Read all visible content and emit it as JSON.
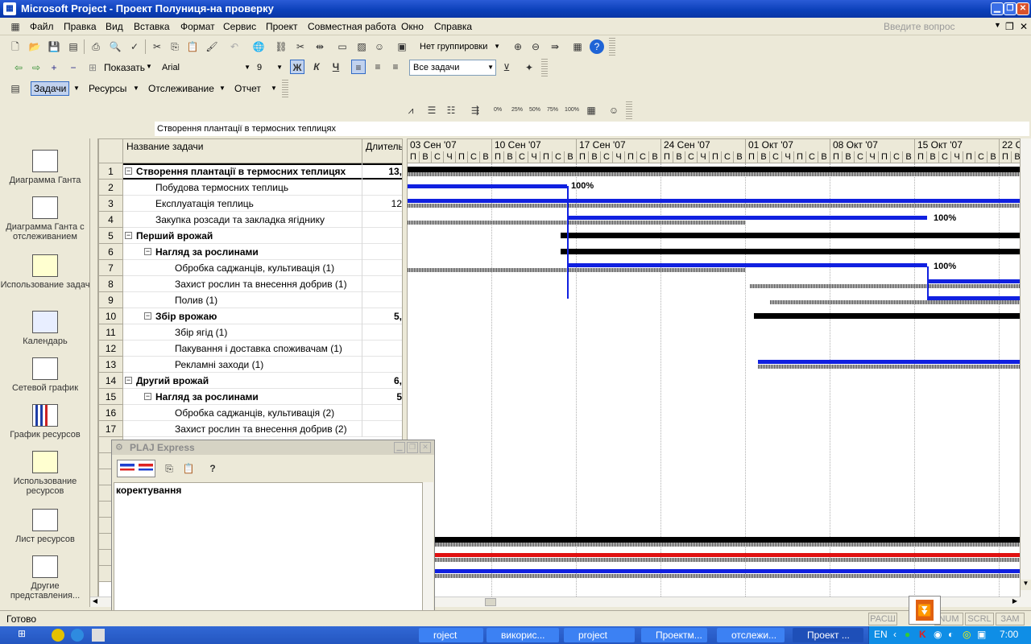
{
  "window": {
    "title": "Microsoft Project - Проект Полуниця-на проверку"
  },
  "menu": [
    "Файл",
    "Правка",
    "Вид",
    "Вставка",
    "Формат",
    "Сервис",
    "Проект",
    "Совместная работа",
    "Окно",
    "Справка"
  ],
  "help_box": {
    "placeholder": "Введите вопрос"
  },
  "toolbar": {
    "grouping": "Нет группировки",
    "show_label": "Показать",
    "font": "Arial",
    "font_size": "9",
    "bold": "Ж",
    "italic": "К",
    "underline": "Ч",
    "filter": "Все задачи",
    "tasks_btn": "Задачи",
    "resources_btn": "Ресурсы",
    "tracking_btn": "Отслеживание",
    "report_btn": "Отчет",
    "pct": [
      "0%",
      "25%",
      "50%",
      "75%",
      "100%"
    ]
  },
  "entry_bar": {
    "value": "Створення плантації  в термосних теплицях"
  },
  "view_bar": [
    {
      "label": "Диаграмма Ганта"
    },
    {
      "label": "Диаграмма Ганта с отслеживанием"
    },
    {
      "label": "Использование задач"
    },
    {
      "label": "Календарь"
    },
    {
      "label": "Сетевой график"
    },
    {
      "label": "График ресурсов"
    },
    {
      "label": "Использование ресурсов"
    },
    {
      "label": "Лист ресурсов"
    },
    {
      "label": "Другие представления..."
    }
  ],
  "grid": {
    "col_name": "Название задачи",
    "col_dur": "Длитель",
    "rows": [
      {
        "id": "1",
        "name": "Створення плантації  в термосних теплицях",
        "dur": "13,",
        "bold": true,
        "collapse": "⊟",
        "indent": 0
      },
      {
        "id": "2",
        "name": "Побудова термосних теплиць",
        "dur": "",
        "bold": false,
        "collapse": "",
        "indent": 1
      },
      {
        "id": "3",
        "name": "Експлуатація теплиць",
        "dur": "12",
        "bold": false,
        "collapse": "",
        "indent": 1
      },
      {
        "id": "4",
        "name": "Закупка розсади та закладка ягіднику",
        "dur": "",
        "bold": false,
        "collapse": "",
        "indent": 1
      },
      {
        "id": "5",
        "name": "Перший врожай",
        "dur": "",
        "bold": true,
        "collapse": "⊟",
        "indent": 0
      },
      {
        "id": "6",
        "name": "Нагляд за рослинами",
        "dur": "",
        "bold": true,
        "collapse": "⊟",
        "indent": 1
      },
      {
        "id": "7",
        "name": "Обробка саджанців, культивація (1)",
        "dur": "",
        "bold": false,
        "collapse": "",
        "indent": 2
      },
      {
        "id": "8",
        "name": "Захист рослин та внесення добрив (1)",
        "dur": "",
        "bold": false,
        "collapse": "",
        "indent": 2
      },
      {
        "id": "9",
        "name": "Полив (1)",
        "dur": "",
        "bold": false,
        "collapse": "",
        "indent": 2
      },
      {
        "id": "10",
        "name": "Збір врожаю",
        "dur": "5,",
        "bold": true,
        "collapse": "⊟",
        "indent": 1
      },
      {
        "id": "11",
        "name": "Збір ягід (1)",
        "dur": "",
        "bold": false,
        "collapse": "",
        "indent": 2
      },
      {
        "id": "12",
        "name": "Пакування  і доставка споживачам (1)",
        "dur": "",
        "bold": false,
        "collapse": "",
        "indent": 2
      },
      {
        "id": "13",
        "name": "Рекламні заходи (1)",
        "dur": "",
        "bold": false,
        "collapse": "",
        "indent": 2
      },
      {
        "id": "14",
        "name": "Другий врожай",
        "dur": "6,",
        "bold": true,
        "collapse": "⊟",
        "indent": 0
      },
      {
        "id": "15",
        "name": "Нагляд за рослинами",
        "dur": "5",
        "bold": true,
        "collapse": "⊟",
        "indent": 1
      },
      {
        "id": "16",
        "name": "Обробка саджанців, культивація  (2)",
        "dur": "",
        "bold": false,
        "collapse": "",
        "indent": 2
      },
      {
        "id": "17",
        "name": "Захист рослин та внесення добрив  (2)",
        "dur": "",
        "bold": false,
        "collapse": "",
        "indent": 2
      }
    ]
  },
  "gantt": {
    "weeks": [
      "03 Сен '07",
      "10 Сен '07",
      "17 Сен '07",
      "24 Сен '07",
      "01 Окт '07",
      "08 Окт '07",
      "15 Окт '07",
      "22 О"
    ],
    "days": [
      "П",
      "В",
      "С",
      "Ч",
      "П",
      "С",
      "В"
    ],
    "pct_labels": [
      "100%",
      "100%",
      "100%"
    ]
  },
  "plaj": {
    "title": "PLAJ Express",
    "text": "коректування"
  },
  "status": {
    "text": "Готово",
    "indicators": [
      "РАСШ",
      "",
      "NUM",
      "SCRL",
      "ЗАМ"
    ]
  },
  "taskbar": {
    "items": [
      "roject",
      "викорис...",
      "project",
      "Проектм...",
      "отслежи...",
      "Проект ..."
    ],
    "lang": "EN",
    "clock": "7:00"
  }
}
